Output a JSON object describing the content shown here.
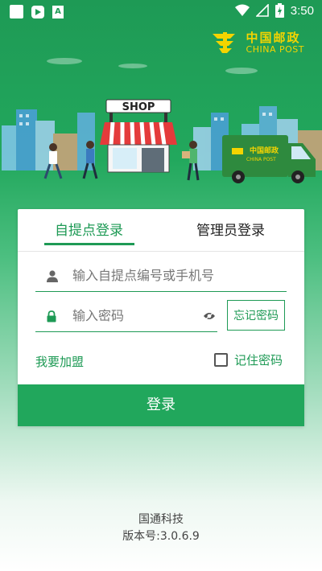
{
  "status_bar": {
    "time": "3:50",
    "icons": [
      "square-notification-icon",
      "app-play-icon",
      "a-notification-icon",
      "wifi-icon",
      "signal-icon",
      "battery-charging-icon"
    ]
  },
  "brand": {
    "name_cn": "中国邮政",
    "name_en": "CHINA POST"
  },
  "illustration": {
    "shop_sign": "SHOP",
    "van_label_cn": "中国邮政",
    "van_label_en": "CHINA POST"
  },
  "tabs": [
    {
      "label": "自提点登录",
      "active": true
    },
    {
      "label": "管理员登录",
      "active": false
    }
  ],
  "account": {
    "placeholder": "输入自提点编号或手机号",
    "value": ""
  },
  "password": {
    "placeholder": "输入密码",
    "value": ""
  },
  "forgot_label": "忘记密码",
  "join_label": "我要加盟",
  "remember": {
    "label": "记住密码",
    "checked": false
  },
  "login_label": "登录",
  "footer": {
    "company": "国通科技",
    "version": "版本号:3.0.6.9"
  },
  "colors": {
    "primary": "#21a75c",
    "brand_yellow": "#f4d400"
  }
}
